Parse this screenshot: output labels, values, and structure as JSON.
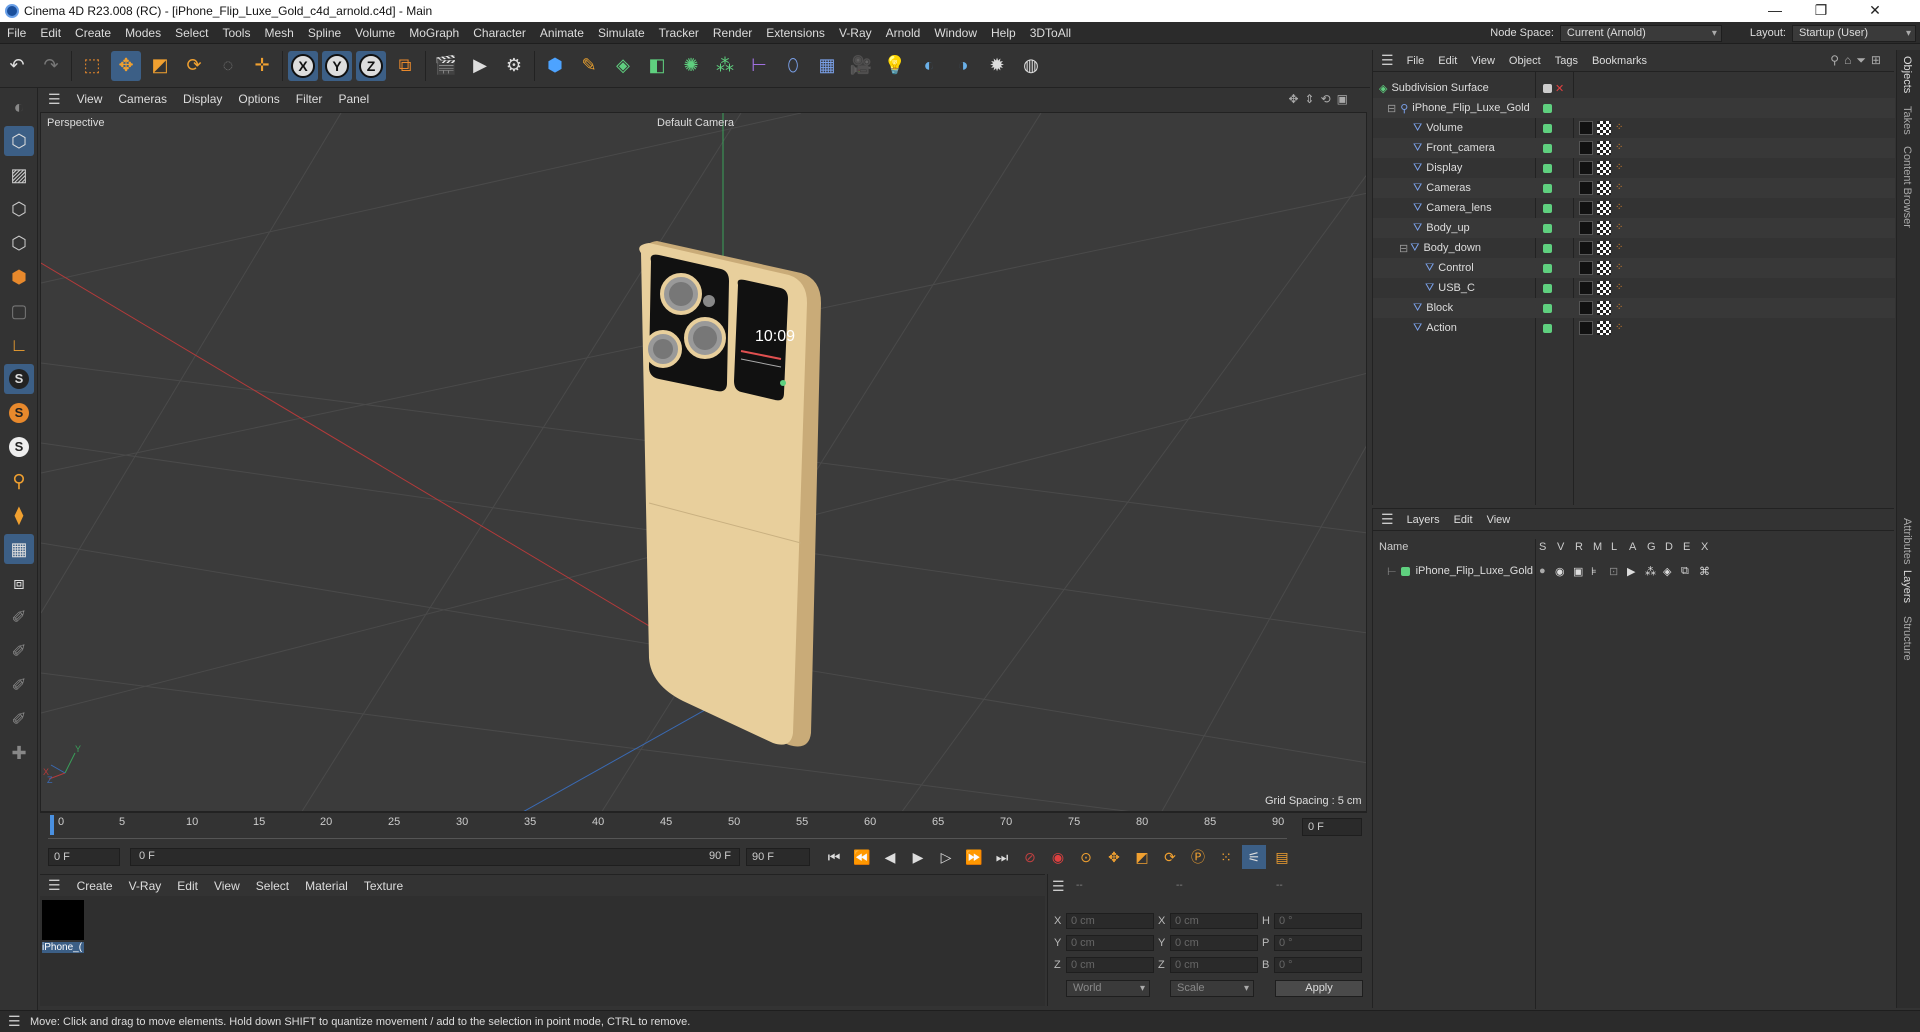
{
  "window": {
    "title": "Cinema 4D R23.008 (RC) - [iPhone_Flip_Luxe_Gold_c4d_arnold.c4d] - Main",
    "controls": [
      "—",
      "❐",
      "✕"
    ]
  },
  "menubar": {
    "items": [
      "File",
      "Edit",
      "Create",
      "Modes",
      "Select",
      "Tools",
      "Mesh",
      "Spline",
      "Volume",
      "MoGraph",
      "Character",
      "Animate",
      "Simulate",
      "Tracker",
      "Render",
      "Extensions",
      "V-Ray",
      "Arnold",
      "Window",
      "Help",
      "3DToAll"
    ],
    "node_space_label": "Node Space:",
    "node_space_value": "Current (Arnold)",
    "layout_label": "Layout:",
    "layout_value": "Startup (User)"
  },
  "toolbar": {
    "axis_x": "X",
    "axis_y": "Y",
    "axis_z": "Z"
  },
  "viewport": {
    "menu": [
      "View",
      "Cameras",
      "Display",
      "Options",
      "Filter",
      "Panel"
    ],
    "view_name": "Perspective",
    "camera_name": "Default Camera",
    "grid_spacing": "Grid Spacing : 5 cm",
    "phone_time": "10:09",
    "axis_labels": {
      "x": "X",
      "y": "Y",
      "z": "Z"
    }
  },
  "timeline": {
    "ticks": [
      "0",
      "5",
      "10",
      "15",
      "20",
      "25",
      "30",
      "35",
      "40",
      "45",
      "50",
      "55",
      "60",
      "65",
      "70",
      "75",
      "80",
      "85",
      "90"
    ],
    "current_frame": "0 F",
    "start_field": "0 F",
    "range_start": "0 F",
    "range_end": "90 F",
    "end_field": "90 F"
  },
  "material_manager": {
    "menu": [
      "Create",
      "V-Ray",
      "Edit",
      "View",
      "Select",
      "Material",
      "Texture"
    ],
    "material_name": "iPhone_("
  },
  "coordinates": {
    "header": [
      "--",
      "--",
      "--"
    ],
    "x_pos": "0 cm",
    "y_pos": "0 cm",
    "z_pos": "0 cm",
    "x_size": "0 cm",
    "y_size": "0 cm",
    "z_size": "0 cm",
    "h_rot": "0 °",
    "p_rot": "0 °",
    "b_rot": "0 °",
    "labels": {
      "x": "X",
      "y": "Y",
      "z": "Z",
      "h": "H",
      "p": "P",
      "b": "B"
    },
    "mode_world": "World",
    "mode_scale": "Scale",
    "apply_label": "Apply"
  },
  "object_manager": {
    "menu": [
      "File",
      "Edit",
      "View",
      "Object",
      "Tags",
      "Bookmarks"
    ],
    "objects": [
      {
        "name": "Subdivision Surface",
        "depth": 0
      },
      {
        "name": "iPhone_Flip_Luxe_Gold",
        "depth": 1
      },
      {
        "name": "Volume",
        "depth": 2
      },
      {
        "name": "Front_camera",
        "depth": 2
      },
      {
        "name": "Display",
        "depth": 2
      },
      {
        "name": "Cameras",
        "depth": 2
      },
      {
        "name": "Camera_lens",
        "depth": 2
      },
      {
        "name": "Body_up",
        "depth": 2
      },
      {
        "name": "Body_down",
        "depth": 2
      },
      {
        "name": "Control",
        "depth": 3
      },
      {
        "name": "USB_C",
        "depth": 3
      },
      {
        "name": "Block",
        "depth": 2
      },
      {
        "name": "Action",
        "depth": 2
      }
    ]
  },
  "layers": {
    "menu": [
      "Layers",
      "Edit",
      "View"
    ],
    "columns": [
      "Name",
      "S",
      "V",
      "R",
      "M",
      "L",
      "A",
      "G",
      "D",
      "E",
      "X"
    ],
    "layer_name": "iPhone_Flip_Luxe_Gold"
  },
  "side_tabs": [
    "Objects",
    "Takes",
    "Content Browser",
    "Attributes",
    "Layers",
    "Structure"
  ],
  "status": {
    "text": "Move: Click and drag to move elements. Hold down SHIFT to quantize movement / add to the selection in point mode, CTRL to remove."
  },
  "colors": {
    "accent": "#3c5f86",
    "phone_gold": "#e8cf9c",
    "object_dot": "#5fd07f",
    "layer_color": "#5fd07f"
  }
}
